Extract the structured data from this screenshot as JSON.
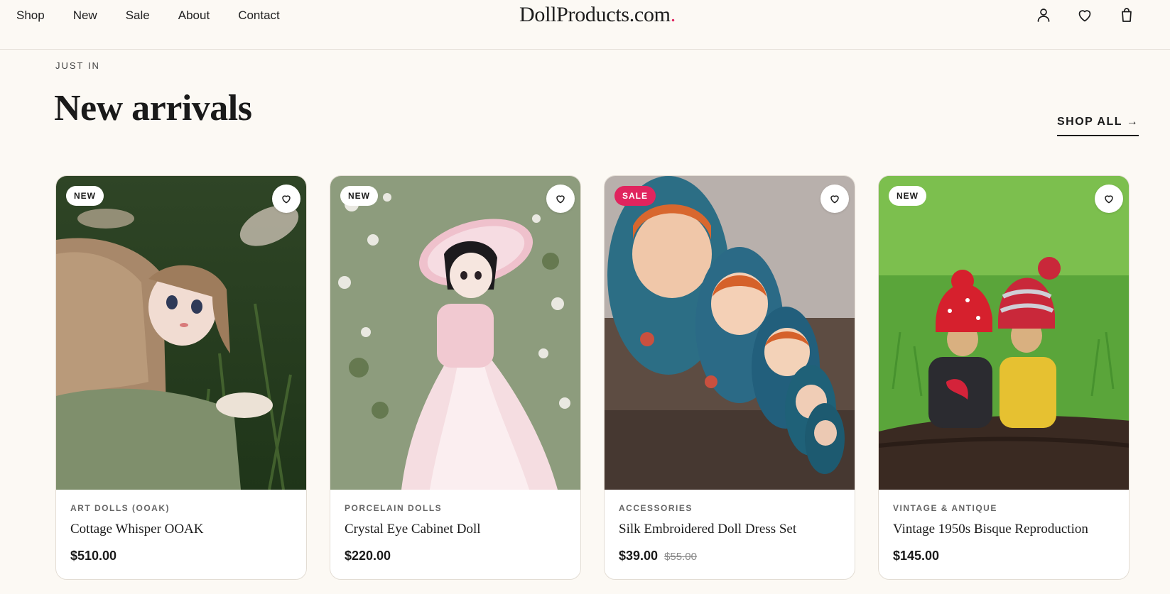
{
  "nav": {
    "items": [
      "Shop",
      "New",
      "Sale",
      "About",
      "Contact"
    ]
  },
  "logo": {
    "name": "DollProducts.com",
    "dot": "."
  },
  "header": {
    "icons": [
      "user-icon",
      "heart-icon",
      "shopping-bag-icon"
    ]
  },
  "section": {
    "eyebrow": "JUST IN",
    "title": "New arrivals",
    "shop_all": "SHOP ALL →"
  },
  "colors": {
    "accent": "#e0245e",
    "background": "#fcf9f4"
  },
  "products": [
    {
      "badge": "NEW",
      "category": "ART DOLLS (OOAK)",
      "name": "Cottage Whisper OOAK",
      "price": "$510.00",
      "old_price": ""
    },
    {
      "badge": "NEW",
      "category": "PORCELAIN DOLLS",
      "name": "Crystal Eye Cabinet Doll",
      "price": "$220.00",
      "old_price": ""
    },
    {
      "badge": "SALE",
      "category": "ACCESSORIES",
      "name": "Silk Embroidered Doll Dress Set",
      "price": "$39.00",
      "old_price": "$55.00"
    },
    {
      "badge": "NEW",
      "category": "VINTAGE & ANTIQUE",
      "name": "Vintage 1950s Bisque Reproduction",
      "price": "$145.00",
      "old_price": ""
    }
  ]
}
